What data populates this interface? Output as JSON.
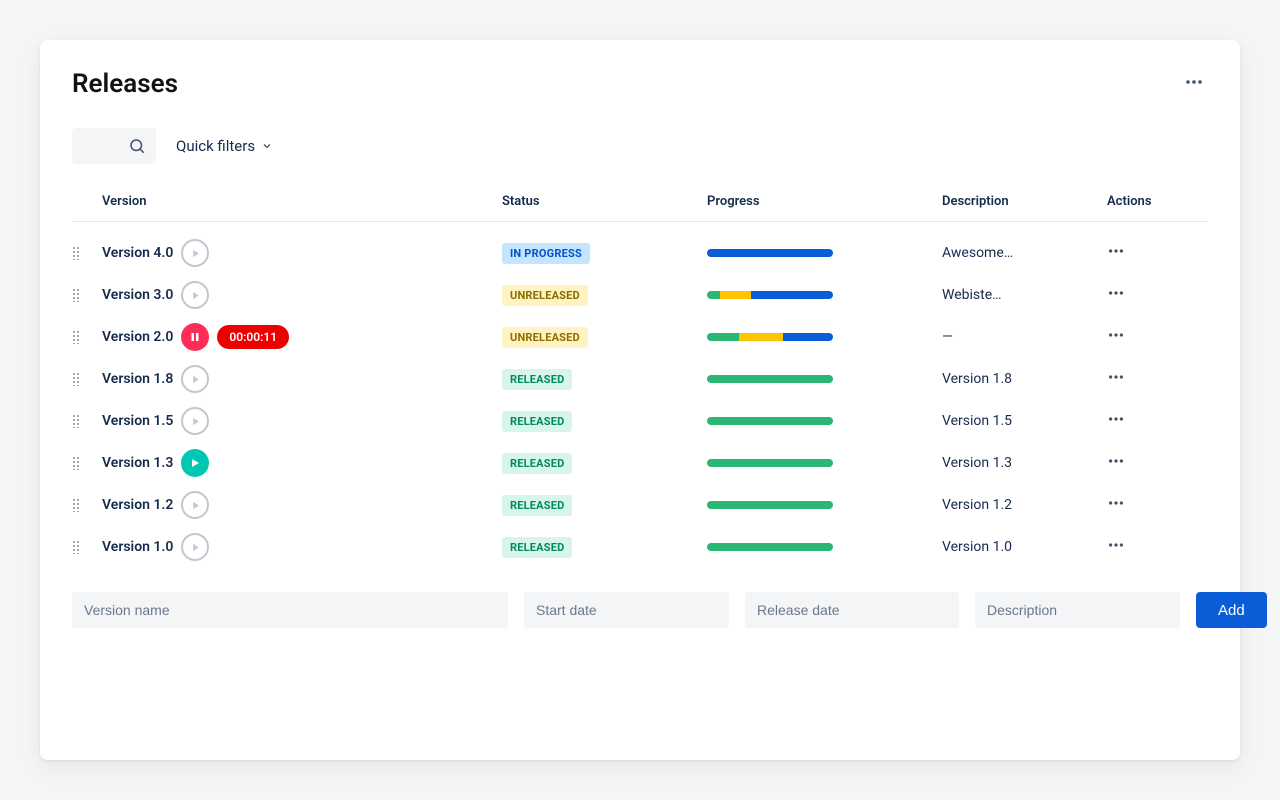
{
  "header": {
    "title": "Releases",
    "quick_filters_label": "Quick filters"
  },
  "columns": {
    "version": "Version",
    "status": "Status",
    "progress": "Progress",
    "description": "Description",
    "actions": "Actions"
  },
  "status_labels": {
    "in_progress": "IN PROGRESS",
    "unreleased": "UNRELEASED",
    "released": "RELEASED"
  },
  "colors": {
    "blue": "#0b5cd7",
    "green": "#2bb673",
    "yellow": "#ffc400",
    "red": "#ed0000",
    "teal": "#00c7b1"
  },
  "rows": [
    {
      "version": "Version 4.0",
      "control": "play-outline",
      "status": "in_progress",
      "progress": [
        {
          "color": "blue",
          "pct": 100
        }
      ],
      "description": "Awesome…"
    },
    {
      "version": "Version 3.0",
      "control": "play-outline",
      "status": "unreleased",
      "progress": [
        {
          "color": "green",
          "pct": 10
        },
        {
          "color": "yellow",
          "pct": 25
        },
        {
          "color": "blue",
          "pct": 65
        }
      ],
      "description": "Webiste…"
    },
    {
      "version": "Version 2.0",
      "control": "pause",
      "timer": "00:00:11",
      "status": "unreleased",
      "progress": [
        {
          "color": "green",
          "pct": 25
        },
        {
          "color": "yellow",
          "pct": 35
        },
        {
          "color": "blue",
          "pct": 40
        }
      ],
      "description": "—"
    },
    {
      "version": "Version 1.8",
      "control": "play-outline",
      "status": "released",
      "progress": [
        {
          "color": "green",
          "pct": 100
        }
      ],
      "description": "Version 1.8"
    },
    {
      "version": "Version 1.5",
      "control": "play-outline",
      "status": "released",
      "progress": [
        {
          "color": "green",
          "pct": 100
        }
      ],
      "description": "Version 1.5"
    },
    {
      "version": "Version 1.3",
      "control": "play-active",
      "status": "released",
      "progress": [
        {
          "color": "green",
          "pct": 100
        }
      ],
      "description": "Version 1.3"
    },
    {
      "version": "Version 1.2",
      "control": "play-outline",
      "status": "released",
      "progress": [
        {
          "color": "green",
          "pct": 100
        }
      ],
      "description": "Version 1.2"
    },
    {
      "version": "Version 1.0",
      "control": "play-outline",
      "status": "released",
      "progress": [
        {
          "color": "green",
          "pct": 100
        }
      ],
      "description": "Version 1.0"
    }
  ],
  "add_form": {
    "name_placeholder": "Version name",
    "start_placeholder": "Start date",
    "release_placeholder": "Release date",
    "description_placeholder": "Description",
    "button_label": "Add"
  }
}
